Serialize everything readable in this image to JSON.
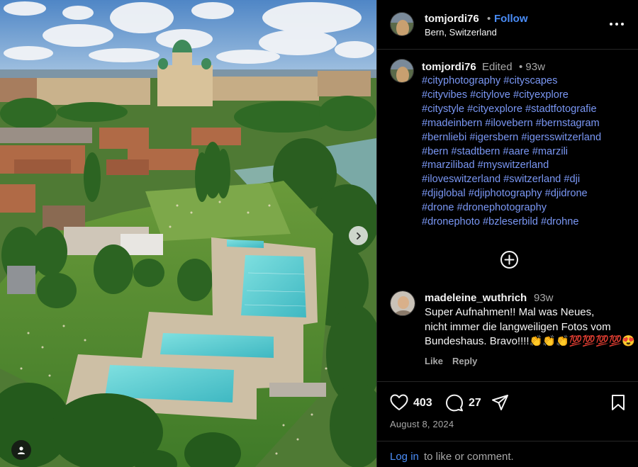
{
  "post": {
    "username": "tomjordi76",
    "dot": "•",
    "follow_label": "Follow",
    "location": "Bern, Switzerland",
    "more_icon": "more-horizontal-icon"
  },
  "caption": {
    "username": "tomjordi76",
    "edited": "Edited",
    "time": "• 93w",
    "hashtag_lines": [
      "#cityphotography #cityscapes",
      "#cityvibes #citylove #cityexplore",
      "#citystyle #cityexplore #stadtfotografie",
      "#madeinbern #ilovebern #bernstagram",
      "#bernliebi #igersbern #igersswitzerland",
      "#bern #stadtbern #aare #marzili",
      "#marzilibad #myswitzerland",
      "#iloveswitzerland #switzerland #dji",
      "#djiglobal #djiphotography #djidrone",
      "#drone #dronephotography",
      "#dronephoto #bzleserbild #drohne"
    ],
    "link_color": "#7a97f4"
  },
  "comment": {
    "username": "madeleine_wuthrich",
    "time": "93w",
    "lines": [
      "Super Aufnahmen!! Mal was Neues,",
      "nicht immer die langweiligen Fotos vom",
      "Bundeshaus. Bravo!!!!👏👏👏💯💯💯💯😍"
    ],
    "like_label": "Like",
    "reply_label": "Reply"
  },
  "actions": {
    "likes": "403",
    "comments": "27",
    "date": "August 8, 2024"
  },
  "login": {
    "link": "Log in",
    "rest": "to like or comment."
  },
  "colors": {
    "background": "#000000",
    "accent": "#4a8df8",
    "muted": "#a8a8a8"
  }
}
